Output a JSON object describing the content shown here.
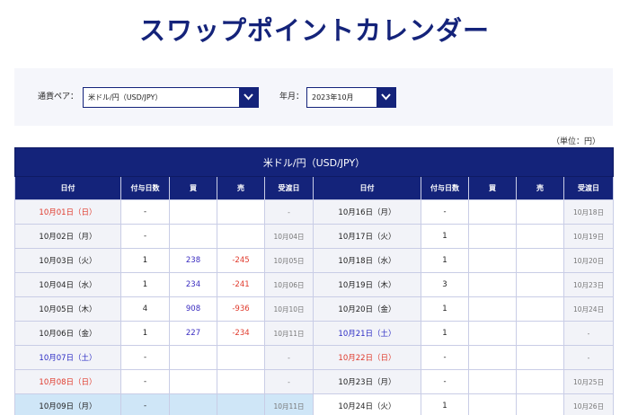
{
  "page": {
    "title": "スワップポイントカレンダー"
  },
  "filters": {
    "pair_label": "通貨ペア：",
    "pair_value": "米ドル/円（USD/JPY）",
    "month_label": "年月：",
    "month_value": "2023年10月"
  },
  "unit": "（単位：円）",
  "table": {
    "caption": "米ドル/円（USD/JPY）",
    "headers": [
      "日付",
      "付与日数",
      "買",
      "売",
      "受渡日",
      "日付",
      "付与日数",
      "買",
      "売",
      "受渡日"
    ],
    "rows": [
      {
        "l": {
          "date": "10月01日（日）",
          "days": "-",
          "buy": "",
          "sell": "",
          "rec": "-"
        },
        "r": {
          "date": "10月16日（月）",
          "days": "-",
          "buy": "",
          "sell": "",
          "rec": "10月18日"
        }
      },
      {
        "l": {
          "date": "10月02日（月）",
          "days": "-",
          "buy": "",
          "sell": "",
          "rec": "10月04日"
        },
        "r": {
          "date": "10月17日（火）",
          "days": "1",
          "buy": "",
          "sell": "",
          "rec": "10月19日"
        }
      },
      {
        "l": {
          "date": "10月03日（火）",
          "days": "1",
          "buy": "238",
          "sell": "-245",
          "rec": "10月05日"
        },
        "r": {
          "date": "10月18日（水）",
          "days": "1",
          "buy": "",
          "sell": "",
          "rec": "10月20日"
        }
      },
      {
        "l": {
          "date": "10月04日（水）",
          "days": "1",
          "buy": "234",
          "sell": "-241",
          "rec": "10月06日"
        },
        "r": {
          "date": "10月19日（木）",
          "days": "3",
          "buy": "",
          "sell": "",
          "rec": "10月23日"
        }
      },
      {
        "l": {
          "date": "10月05日（木）",
          "days": "4",
          "buy": "908",
          "sell": "-936",
          "rec": "10月10日"
        },
        "r": {
          "date": "10月20日（金）",
          "days": "1",
          "buy": "",
          "sell": "",
          "rec": "10月24日"
        }
      },
      {
        "l": {
          "date": "10月06日（金）",
          "days": "1",
          "buy": "227",
          "sell": "-234",
          "rec": "10月11日"
        },
        "r": {
          "date": "10月21日（土）",
          "days": "1",
          "buy": "",
          "sell": "",
          "rec": "-"
        }
      },
      {
        "l": {
          "date": "10月07日（土）",
          "days": "-",
          "buy": "",
          "sell": "",
          "rec": "-"
        },
        "r": {
          "date": "10月22日（日）",
          "days": "-",
          "buy": "",
          "sell": "",
          "rec": "-"
        }
      },
      {
        "l": {
          "date": "10月08日（日）",
          "days": "-",
          "buy": "",
          "sell": "",
          "rec": "-"
        },
        "r": {
          "date": "10月23日（月）",
          "days": "-",
          "buy": "",
          "sell": "",
          "rec": "10月25日"
        }
      },
      {
        "l": {
          "date": "10月09日（月）",
          "days": "-",
          "buy": "",
          "sell": "",
          "rec": "10月11日"
        },
        "r": {
          "date": "10月24日（火）",
          "days": "1",
          "buy": "",
          "sell": "",
          "rec": "10月26日"
        }
      }
    ]
  }
}
